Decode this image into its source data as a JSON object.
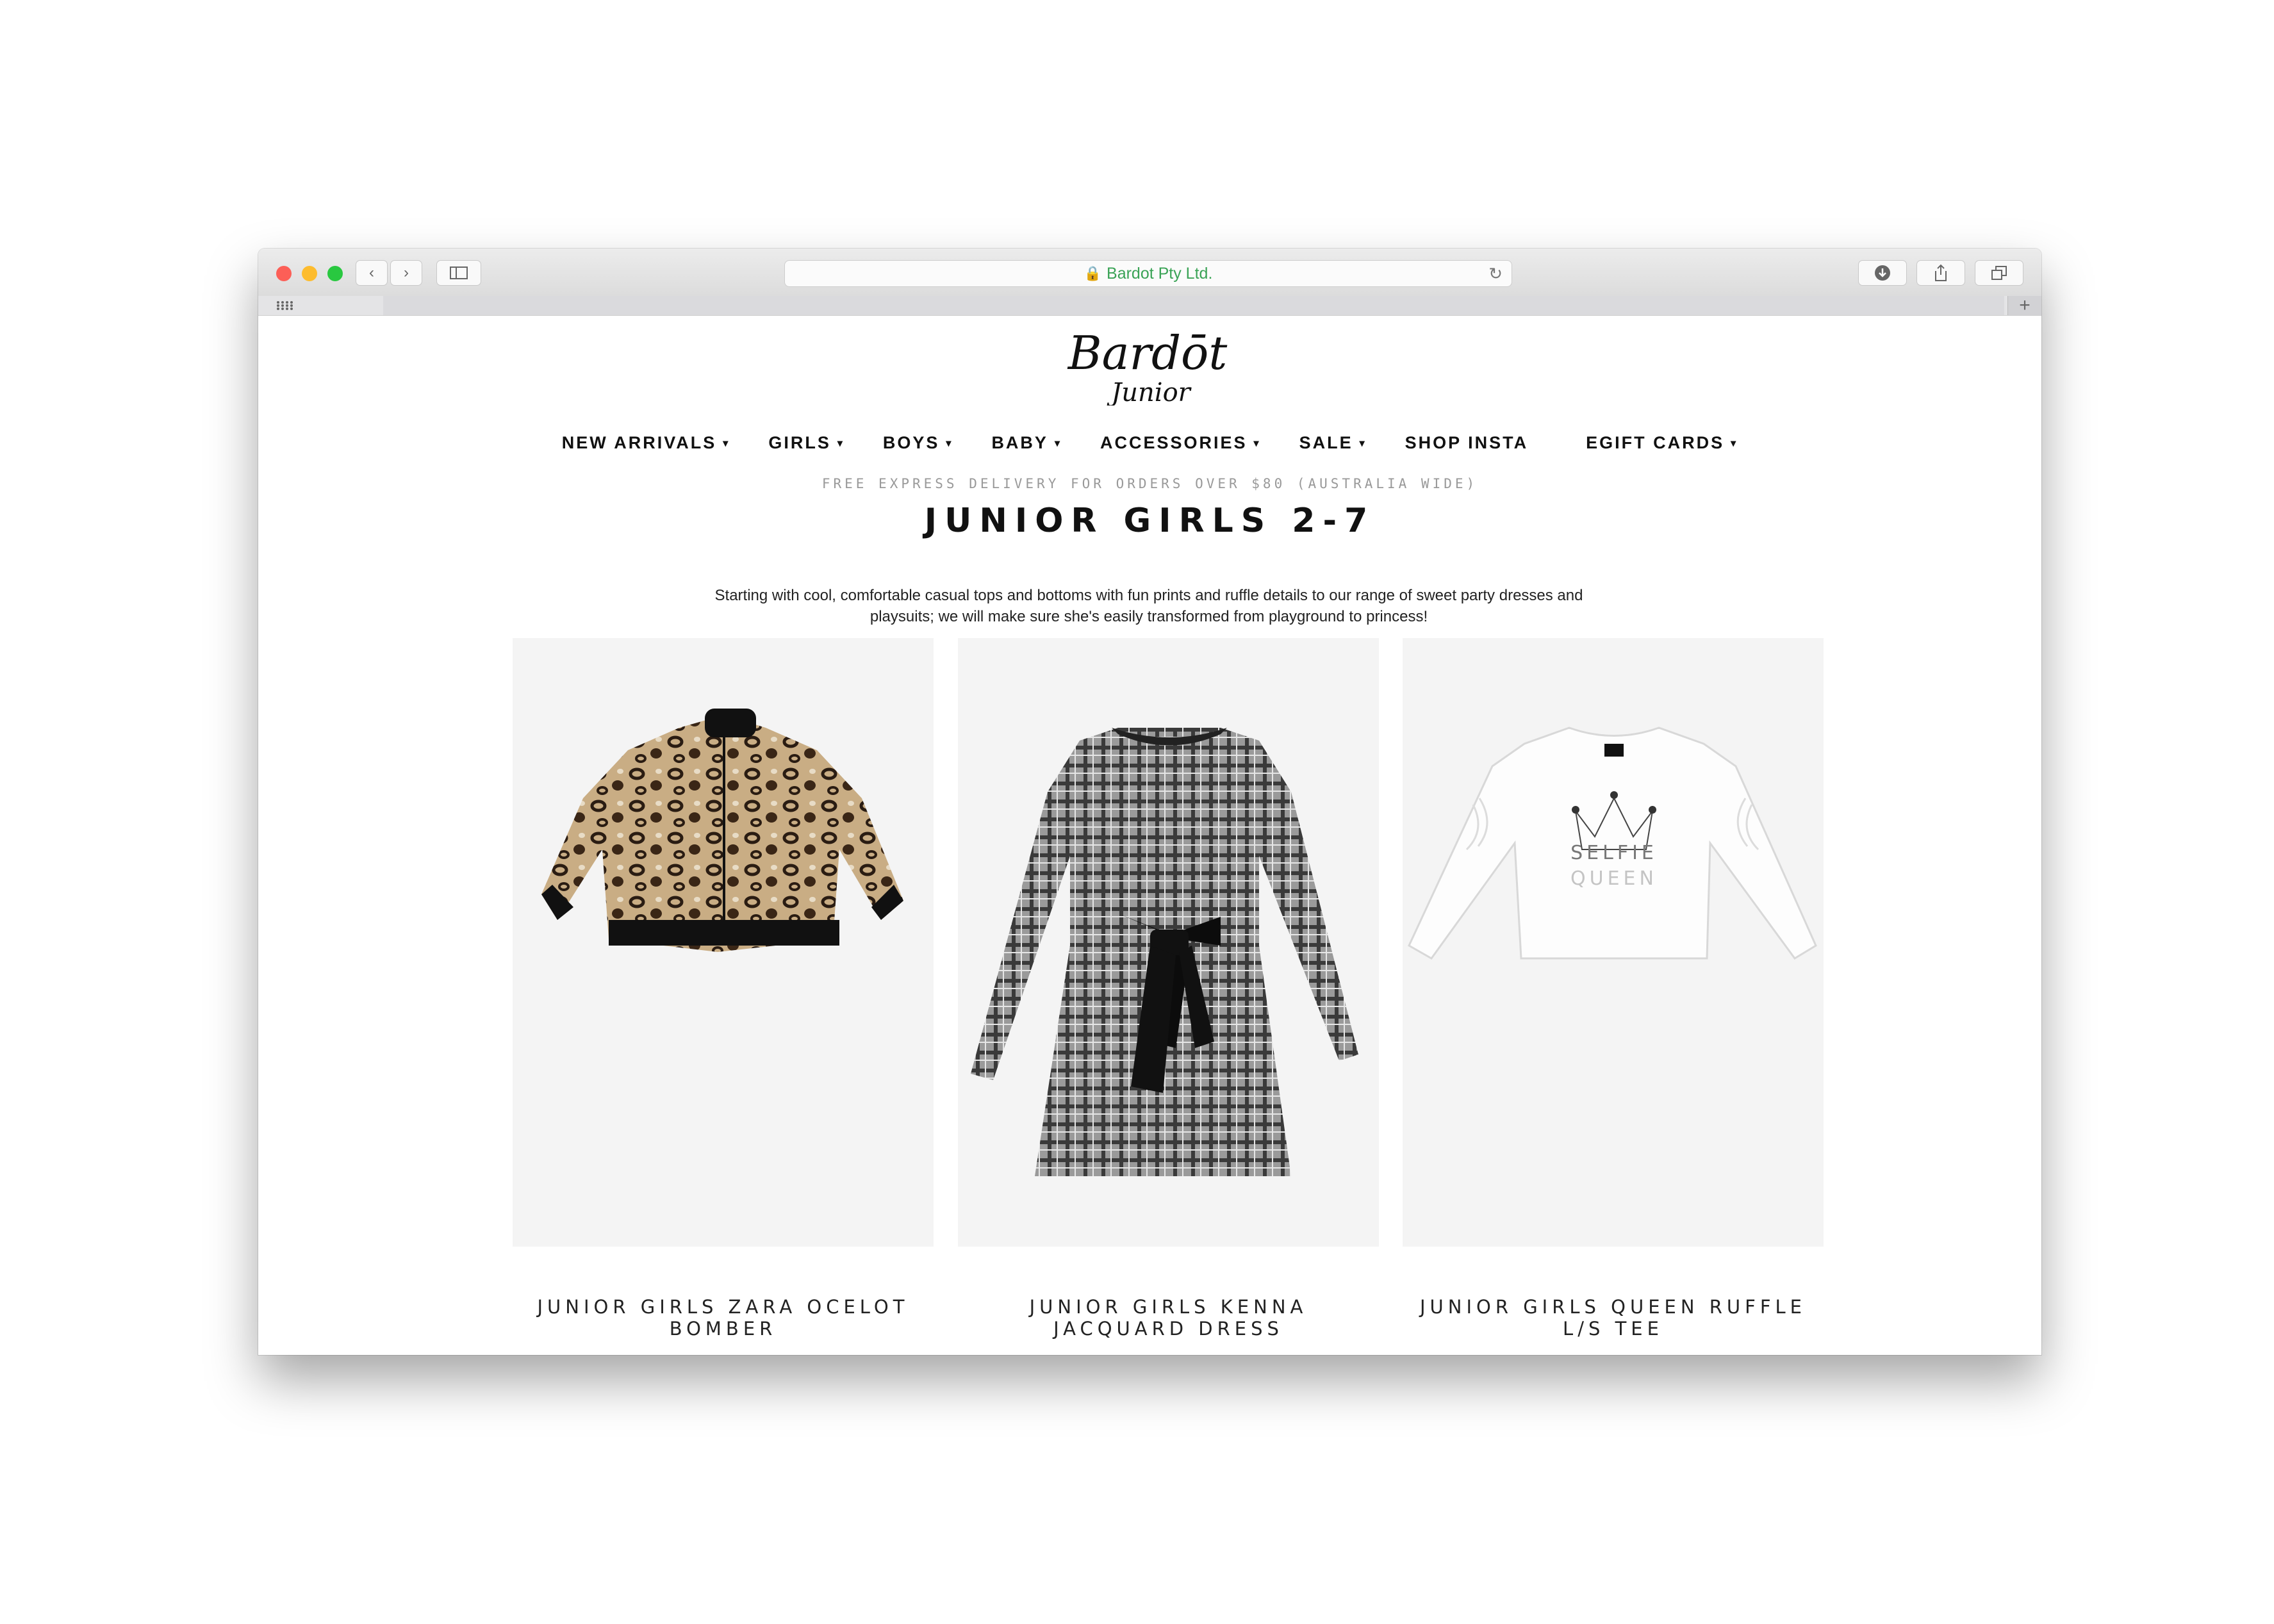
{
  "browser": {
    "url_text": "Bardot Pty Ltd.",
    "icons": {
      "close": "red-dot",
      "minimize": "yellow-dot",
      "maximize": "green-dot",
      "back": "chevron-left-icon",
      "forward": "chevron-right-icon",
      "sidebar": "sidebar-icon",
      "lock": "lock-icon",
      "reload": "reload-icon",
      "download": "download-icon",
      "share": "share-icon",
      "tabs": "tabs-icon",
      "grid": "grid-icon",
      "new_tab": "plus-icon"
    },
    "colors": {
      "close": "#fc5f57",
      "minimize": "#fdbc2e",
      "maximize": "#29c840",
      "secure": "#3aa356"
    }
  },
  "site": {
    "logo_text": "Bardōt",
    "logo_sub": "Junior",
    "nav": [
      {
        "label": "NEW ARRIVALS",
        "caret": "▾"
      },
      {
        "label": "GIRLS",
        "caret": "▾"
      },
      {
        "label": "BOYS",
        "caret": "▾"
      },
      {
        "label": "BABY",
        "caret": "▾"
      },
      {
        "label": "ACCESSORIES",
        "caret": "▾"
      },
      {
        "label": "SALE",
        "caret": "▾"
      },
      {
        "label": "SHOP INSTA",
        "caret": ""
      },
      {
        "label": "EGIFT CARDS",
        "caret": "▾"
      }
    ],
    "promo": "FREE EXPRESS DELIVERY FOR ORDERS OVER $80 (AUSTRALIA WIDE)",
    "page_title": "JUNIOR GIRLS 2-7",
    "description_line1": "Starting with cool, comfortable casual tops and bottoms with fun prints and ruffle details to our range of sweet party dresses and",
    "description_line2": "playsuits; we will make sure she's easily transformed from playground to princess!"
  },
  "products": [
    {
      "name_line1": "JUNIOR GIRLS ZARA OCELOT",
      "name_line2": "BOMBER"
    },
    {
      "name_line1": "JUNIOR GIRLS KENNA",
      "name_line2": "JACQUARD DRESS"
    },
    {
      "name_line1": "JUNIOR GIRLS QUEEN RUFFLE",
      "name_line2": "L/S TEE",
      "tee_print_1": "SELFIE",
      "tee_print_2": "QUEEN"
    }
  ]
}
